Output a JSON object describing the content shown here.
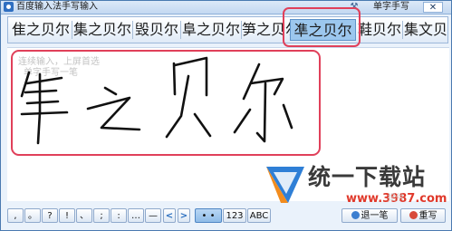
{
  "window": {
    "title": "百度输入法手写输入",
    "mode_label": "单字手写",
    "close_glyph": "✕"
  },
  "candidates": [
    {
      "label": "隹之贝尔",
      "selected": false
    },
    {
      "label": "集之贝尔",
      "selected": false
    },
    {
      "label": "毁贝尔",
      "selected": false
    },
    {
      "label": "阜之贝尔",
      "selected": false
    },
    {
      "label": "笋之贝尔",
      "selected": false
    },
    {
      "label": "凖之贝尔",
      "selected": true
    },
    {
      "label": "鞋贝尔",
      "selected": false
    },
    {
      "label": "集文贝",
      "selected": false
    }
  ],
  "writing_area": {
    "hint_line1": "连续输入，上屏首选",
    "hint_line2": "单字手写一笔"
  },
  "watermark": {
    "brand": "统一下载站",
    "site": "www.3987.com",
    "faint": "提供"
  },
  "toolbar": {
    "punct_buttons": [
      ",",
      "。",
      "?",
      "!",
      "、",
      ";",
      ":",
      "…",
      "—"
    ],
    "prev_glyph": "<",
    "next_glyph": ">",
    "mode_dots": "• •",
    "mode_num": "123",
    "mode_abc": "ABC",
    "undo_label": "退一笔",
    "rewrite_label": "重写"
  },
  "colors": {
    "highlight_box": "#e0405a",
    "selected_candidate": "#9cc7ee",
    "frame": "#4a7ab0"
  }
}
